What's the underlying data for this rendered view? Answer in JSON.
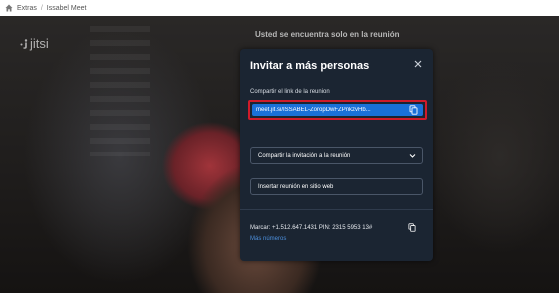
{
  "breadcrumb": {
    "home_icon": "home-icon",
    "items": [
      "Extras",
      "Issabel Meet"
    ],
    "separator": "/"
  },
  "meeting": {
    "logo_text": "jitsi",
    "alone_message": "Usted se encuentra solo en la reunión"
  },
  "dialog": {
    "title": "Invitar a más personas",
    "share_link_label": "Compartir el link de la reunion",
    "meeting_link": "meet.jit.si/ISSABEL-ZoropDwFZPnkzvHb...",
    "share_invite_label": "Compartir la invitación a la reunión",
    "embed_label": "Insertar reunión en sitio web",
    "dial_in": "Marcar: +1.512.647.1431 PIN: 2315 5953 13#",
    "more_numbers": "Más números"
  },
  "colors": {
    "dialog_bg": "#1b2532",
    "link_bg": "#1a71d8",
    "highlight": "#d01b2a",
    "link_accent": "#4c8fdc"
  }
}
